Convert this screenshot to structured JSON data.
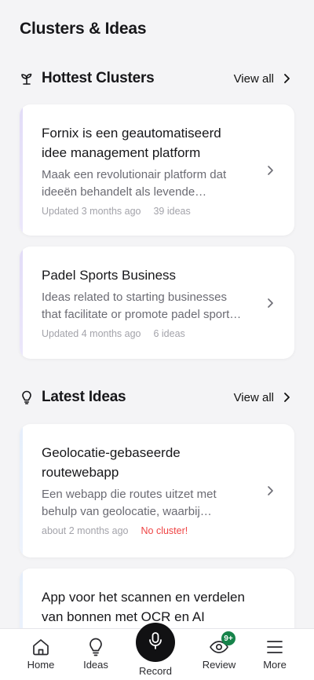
{
  "page": {
    "title": "Clusters & Ideas"
  },
  "hottest": {
    "title": "Hottest Clusters",
    "view_all": "View all",
    "items": [
      {
        "title_lines": [
          "Fornix is een geautomatiseerd",
          "idee management platform"
        ],
        "desc_lines": [
          "Maak een revolutionair platform dat",
          "ideeën behandelt als levende…"
        ],
        "updated": "Updated 3 months ago",
        "count": "39 ideas"
      },
      {
        "title_lines": [
          "Padel Sports Business"
        ],
        "desc_lines": [
          "Ideas related to starting businesses",
          "that facilitate or promote padel sport…"
        ],
        "updated": "Updated 4 months ago",
        "count": "6 ideas"
      }
    ]
  },
  "latest": {
    "title": "Latest Ideas",
    "view_all": "View all",
    "items": [
      {
        "title_lines": [
          "Geolocatie-gebaseerde",
          "routewebapp"
        ],
        "desc_lines": [
          "Een webapp die routes uitzet met",
          "behulp van geolocatie, waarbij…"
        ],
        "age": "about 2 months ago",
        "cluster_status": "No cluster!"
      },
      {
        "title_lines": [
          "App voor het scannen en verdelen",
          "van bonnen met OCR en AI"
        ]
      }
    ]
  },
  "nav": {
    "home": "Home",
    "ideas": "Ideas",
    "record": "Record",
    "review": "Review",
    "review_badge": "9+",
    "more": "More"
  },
  "colors": {
    "accent_badge": "#16834a",
    "warning": "#ef4444"
  }
}
